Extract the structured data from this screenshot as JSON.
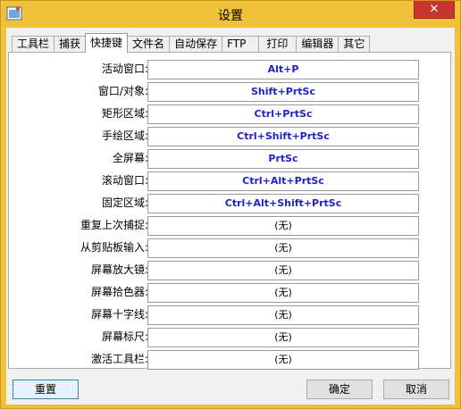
{
  "window": {
    "title": "设置",
    "close_glyph": "✕"
  },
  "tabs": [
    {
      "label": "工具栏"
    },
    {
      "label": "捕获"
    },
    {
      "label": "快捷键",
      "active": true
    },
    {
      "label": "文件名"
    },
    {
      "label": "自动保存"
    },
    {
      "label": "FTP"
    },
    {
      "label": "打印"
    },
    {
      "label": "编辑器"
    },
    {
      "label": "其它"
    }
  ],
  "hotkeys": [
    {
      "label": "活动窗口:",
      "value": "Alt+P"
    },
    {
      "label": "窗口/对象:",
      "value": "Shift+PrtSc"
    },
    {
      "label": "矩形区域:",
      "value": "Ctrl+PrtSc"
    },
    {
      "label": "手绘区域:",
      "value": "Ctrl+Shift+PrtSc"
    },
    {
      "label": "全屏幕:",
      "value": "PrtSc"
    },
    {
      "label": "滚动窗口:",
      "value": "Ctrl+Alt+PrtSc"
    },
    {
      "label": "固定区域:",
      "value": "Ctrl+Alt+Shift+PrtSc"
    },
    {
      "label": "重复上次捕捉:",
      "value": "(无)"
    },
    {
      "label": "从剪贴板输入:",
      "value": "(无)"
    },
    {
      "label": "屏幕放大镜:",
      "value": "(无)"
    },
    {
      "label": "屏幕拾色器:",
      "value": "(无)"
    },
    {
      "label": "屏幕十字线:",
      "value": "(无)"
    },
    {
      "label": "屏幕标尺:",
      "value": "(无)"
    },
    {
      "label": "激活工具栏:",
      "value": "(无)"
    }
  ],
  "buttons": {
    "reset": "重置",
    "ok": "确定",
    "cancel": "取消"
  },
  "colors": {
    "titlebar": "#f0c23b",
    "hotkey_set": "#1f1fcf",
    "close": "#c7352c"
  }
}
